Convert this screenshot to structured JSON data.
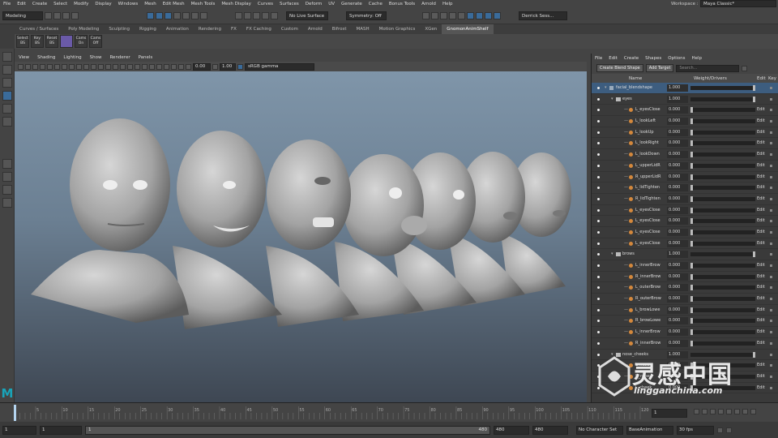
{
  "menubar": [
    "File",
    "Edit",
    "Create",
    "Select",
    "Modify",
    "Display",
    "Windows",
    "Mesh",
    "Edit Mesh",
    "Mesh Tools",
    "Mesh Display",
    "Curves",
    "Surfaces",
    "Deform",
    "UV",
    "Generate",
    "Cache",
    "Bonus Tools",
    "Arnold",
    "Help"
  ],
  "workspace_label": "Workspace :",
  "workspace_value": "Maya Classic*",
  "mode_select": "Modeling",
  "live_surface": "No Live Surface",
  "symmetry": "Symmetry: Off",
  "user": "Derrick Sess...",
  "shelf_tabs": [
    "Curves / Surfaces",
    "Poly Modeling",
    "Sculpting",
    "Rigging",
    "Animation",
    "Rendering",
    "FX",
    "FX Caching",
    "Custom",
    "Arnold",
    "Bifrost",
    "MASH",
    "Motion Graphics",
    "XGen",
    "GnomonAnimShelf"
  ],
  "shelf_active": "GnomonAnimShelf",
  "shelf_buttons": [
    [
      "Select",
      "BS"
    ],
    [
      "Key",
      "BS"
    ],
    [
      "Reset",
      "BS"
    ],
    [
      "",
      ""
    ],
    [
      "Cams",
      "On"
    ],
    [
      "Cams",
      "Off"
    ]
  ],
  "viewport_menu": [
    "View",
    "Shading",
    "Lighting",
    "Show",
    "Renderer",
    "Panels"
  ],
  "vp_val1": "0.00",
  "vp_val2": "1.00",
  "color_space": "sRGB gamma",
  "rp_menu": [
    "File",
    "Edit",
    "Create",
    "Shapes",
    "Options",
    "Help"
  ],
  "create_blend": "Create Blend Shape",
  "add_target": "Add Target",
  "search_ph": "Search...",
  "col_name": "Name",
  "col_weight": "Weight/Drivers",
  "col_edit": "Edit",
  "col_key": "Key",
  "rows": [
    {
      "name": "facial_blendshape",
      "val": "1.000",
      "lvl": 0,
      "sel": true,
      "type": "root"
    },
    {
      "name": "eyes",
      "val": "1.000",
      "lvl": 1,
      "type": "group"
    },
    {
      "name": "L_eyesClose",
      "val": "0.000",
      "lvl": 2,
      "type": "t"
    },
    {
      "name": "L_lookLeft",
      "val": "0.000",
      "lvl": 2,
      "type": "t"
    },
    {
      "name": "L_lookUp",
      "val": "0.000",
      "lvl": 2,
      "type": "t"
    },
    {
      "name": "L_lookRight",
      "val": "0.000",
      "lvl": 2,
      "type": "t"
    },
    {
      "name": "L_lookDown",
      "val": "0.000",
      "lvl": 2,
      "type": "t"
    },
    {
      "name": "L_upperLidR",
      "val": "0.000",
      "lvl": 2,
      "type": "t"
    },
    {
      "name": "R_upperLidR",
      "val": "0.000",
      "lvl": 2,
      "type": "t"
    },
    {
      "name": "L_lidTighten",
      "val": "0.000",
      "lvl": 2,
      "type": "t"
    },
    {
      "name": "R_lidTighten",
      "val": "0.000",
      "lvl": 2,
      "type": "t"
    },
    {
      "name": "L_eyesClose",
      "val": "0.000",
      "lvl": 2,
      "type": "t"
    },
    {
      "name": "L_eyesClose",
      "val": "0.000",
      "lvl": 2,
      "type": "t"
    },
    {
      "name": "L_eyesClose",
      "val": "0.000",
      "lvl": 2,
      "type": "t"
    },
    {
      "name": "L_eyesClose",
      "val": "0.000",
      "lvl": 2,
      "type": "t"
    },
    {
      "name": "brows",
      "val": "1.000",
      "lvl": 1,
      "type": "group"
    },
    {
      "name": "L_innerBrow",
      "val": "0.000",
      "lvl": 2,
      "type": "t"
    },
    {
      "name": "R_innerBrow",
      "val": "0.000",
      "lvl": 2,
      "type": "t"
    },
    {
      "name": "L_outerBrow",
      "val": "0.000",
      "lvl": 2,
      "type": "t"
    },
    {
      "name": "R_outerBrow",
      "val": "0.000",
      "lvl": 2,
      "type": "t"
    },
    {
      "name": "L_browLowe",
      "val": "0.000",
      "lvl": 2,
      "type": "t"
    },
    {
      "name": "R_browLowe",
      "val": "0.000",
      "lvl": 2,
      "type": "t"
    },
    {
      "name": "L_innerBrow",
      "val": "0.000",
      "lvl": 2,
      "type": "t"
    },
    {
      "name": "R_innerBrow",
      "val": "0.000",
      "lvl": 2,
      "type": "t"
    },
    {
      "name": "nose_cheeks",
      "val": "1.000",
      "lvl": 1,
      "type": "group"
    },
    {
      "name": "L_nose",
      "val": "0.000",
      "lvl": 2,
      "type": "t"
    },
    {
      "name": "R_nose",
      "val": "0.000",
      "lvl": 2,
      "type": "t"
    },
    {
      "name": "L_cheek",
      "val": "0.000",
      "lvl": 2,
      "type": "t"
    }
  ],
  "edit_label": "Edit",
  "range_start": "1",
  "range_start2": "1",
  "range_thumb": "1",
  "range_end": "480",
  "range_end2": "480",
  "range_end3": "480",
  "timeline_ticks": [
    "5",
    "10",
    "15",
    "20",
    "25",
    "30",
    "35",
    "40",
    "45",
    "50",
    "55",
    "60",
    "65",
    "70",
    "75",
    "80",
    "85",
    "90",
    "95",
    "100",
    "105",
    "110",
    "115",
    "120"
  ],
  "current_frame": "1",
  "char_set": "No Character Set",
  "anim_layer": "BaseAnimation",
  "fps": "30 fps",
  "watermark_cn": "灵感中国",
  "watermark_url": "lingganchina.com",
  "maya_logo": "M"
}
